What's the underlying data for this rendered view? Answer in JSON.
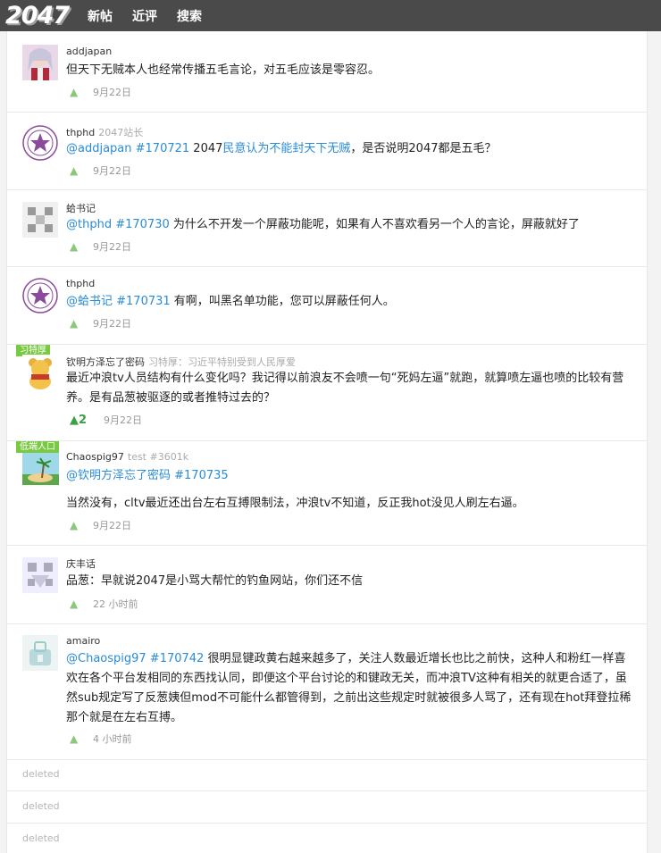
{
  "header": {
    "logo": "2047",
    "nav": [
      "新帖",
      "近评",
      "搜索"
    ]
  },
  "posts": [
    {
      "author": "addjapan",
      "subtitle": "",
      "body": [
        {
          "t": "但天下无贼本人也经常传播五毛言论，对五毛应该是零容忍。"
        }
      ],
      "upvotes": "",
      "time": "9月22日"
    },
    {
      "author": "thphd",
      "subtitle": "2047站长",
      "body": [
        {
          "t": "@addjapan #170721",
          "link": true
        },
        {
          "t": " 2047"
        },
        {
          "t": "民意认为不能封天下无贼",
          "link": true
        },
        {
          "t": "，是否说明2047都是五毛？"
        }
      ],
      "upvotes": "",
      "time": "9月22日"
    },
    {
      "author": "蛤书记",
      "subtitle": "",
      "body": [
        {
          "t": "@thphd #170730",
          "link": true
        },
        {
          "t": " 为什么不开发一个屏蔽功能呢，如果有人不喜欢看另一个人的言论，屏蔽就好了"
        }
      ],
      "upvotes": "",
      "time": "9月22日"
    },
    {
      "author": "thphd",
      "subtitle": "",
      "body": [
        {
          "t": "@蛤书记 #170731",
          "link": true
        },
        {
          "t": " 有啊，叫黑名单功能，您可以屏蔽任何人。"
        }
      ],
      "upvotes": "",
      "time": "9月22日"
    },
    {
      "author": "钦明方泽忘了密码",
      "subtitle": "习特厚：习近平特别受到人民厚爱",
      "tag": "习特厚",
      "body": [
        {
          "t": "最近冲浪tv人员结构有什么变化吗？我记得以前浪友不会喷一句“死妈左逼”就跑，就算喷左逼也喷的比较有营养。是有品葱被驱逐的或者推特过去的？"
        }
      ],
      "upvotes": "2",
      "time": "9月22日"
    },
    {
      "author": "Chaospig97",
      "subtitle": "test #3601k",
      "tag": "低端人口",
      "body": [
        {
          "t": "@钦明方泽忘了密码 #170735",
          "link": true
        }
      ],
      "body2": "当然没有，cltv最近还出台左右互搏限制法，冲浪tv不知道，反正我hot没见人刷左右逼。",
      "upvotes": "",
      "time": "9月22日"
    },
    {
      "author": "庆丰话",
      "subtitle": "",
      "body": [
        {
          "t": "品葱：早就说2047是小骂大帮忙的钓鱼网站，你们还不信"
        }
      ],
      "upvotes": "",
      "time": "22 小时前"
    },
    {
      "author": "amairo",
      "subtitle": "",
      "body": [
        {
          "t": "@Chaospig97 #170742",
          "link": true
        },
        {
          "t": " 很明显键政黄右越来越多了，关注人数最近增长也比之前快，这种人和粉红一样喜欢在各个平台发相同的东西找认同，即便这个平台讨论的和键政无关，而冲浪TV这种有相关的就更合适了，虽然sub规定写了反葱姨但mod不可能什么都管得到，之前出这些规定时就被很多人骂了，还有现在hot拜登拉稀那个就是在左右互搏。"
        }
      ],
      "upvotes": "",
      "time": "4 小时前"
    }
  ],
  "deleted_label": "deleted",
  "deleted_rows": [
    "deleted",
    "deleted",
    "deleted"
  ]
}
